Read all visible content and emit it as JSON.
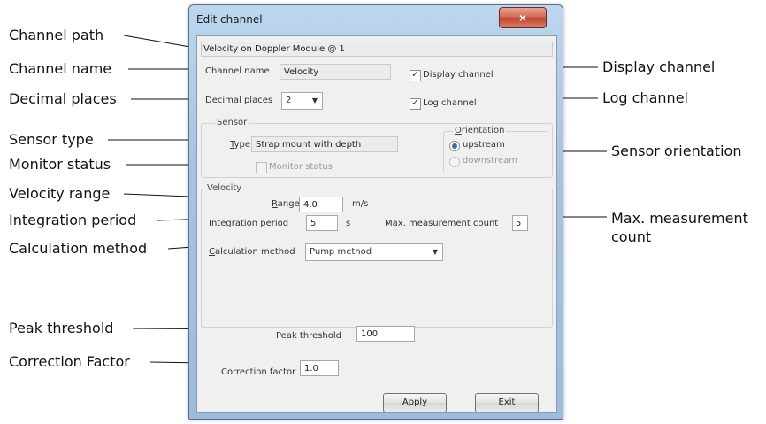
{
  "dialog": {
    "title": "Edit channel",
    "close_glyph": "×",
    "channel_path": "Velocity on Doppler Module @ 1",
    "channel_name_label": "Channel name",
    "channel_name_value": "Velocity",
    "display_channel_label": "Display channel",
    "display_channel_checked": true,
    "decimal_places_label": "Decimal places",
    "decimal_places_value": "2",
    "log_channel_label": "Log channel",
    "log_channel_checked": true,
    "sensor_group_label": "Sensor",
    "type_label": "Type",
    "type_value": "Strap mount with depth",
    "monitor_status_label": "Monitor status",
    "monitor_status_checked": false,
    "orientation_group_label": "Orientation",
    "orientation_options": [
      "upstream",
      "downstream"
    ],
    "orientation_selected": "upstream",
    "velocity_group_label": "Velocity",
    "range_label": "Range",
    "range_value": "4.0",
    "range_unit": "m/s",
    "integration_period_label": "Integration period",
    "integration_period_value": "5",
    "integration_period_unit": "s",
    "max_measurement_count_label": "Max. measurement count",
    "max_measurement_count_value": "5",
    "calculation_method_label": "Calculation method",
    "calculation_method_value": "Pump method",
    "peak_threshold_label": "Peak threshold",
    "peak_threshold_value": "100",
    "correction_factor_label": "Correction factor",
    "correction_factor_value": "1.0",
    "apply_label": "Apply",
    "exit_label": "Exit",
    "dropdown_glyph": "▼",
    "check_glyph": "✓"
  },
  "callouts": {
    "channel_path": "Channel path",
    "channel_name": "Channel name",
    "decimal_places": "Decimal places",
    "sensor_type": "Sensor type",
    "monitor_status": "Monitor status",
    "velocity_range": "Velocity range",
    "integration_period": "Integration period",
    "calculation_method": "Calculation method",
    "peak_threshold": "Peak threshold",
    "correction_factor": "Correction Factor",
    "display_channel": "Display channel",
    "log_channel": "Log channel",
    "sensor_orientation": "Sensor orientation",
    "max_measurement_count": "Max. measurement count"
  },
  "colors": {
    "window_frame": "#a6c3e3",
    "close_button": "#c0442b",
    "check_mark": "#2a4d8a",
    "radio_dot": "#3a6bb5"
  }
}
